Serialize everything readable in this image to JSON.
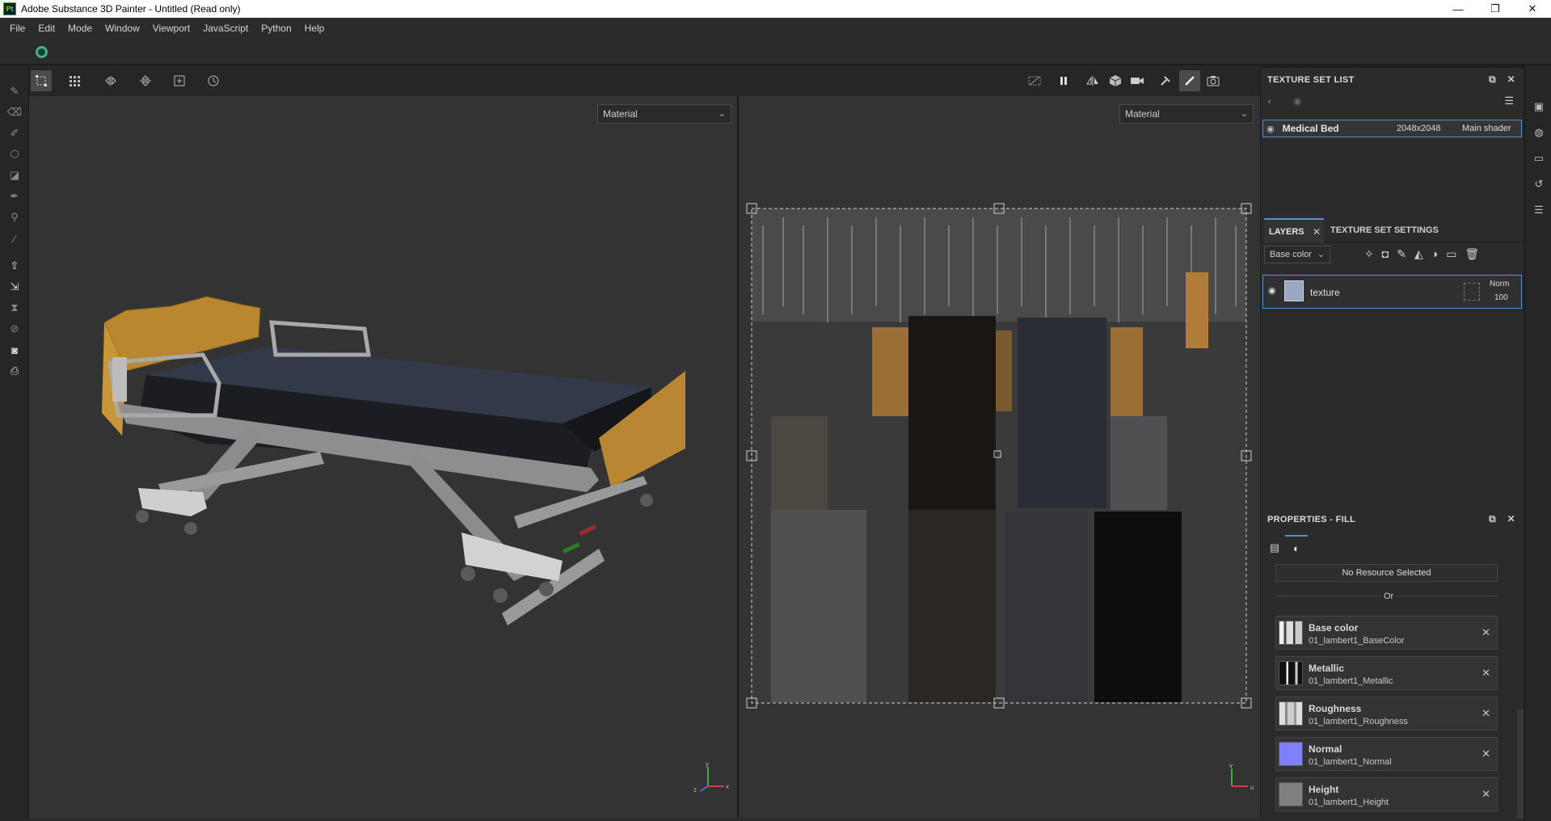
{
  "window": {
    "title": "Adobe Substance 3D Painter - Untitled (Read only)",
    "app_icon_text": "Pt",
    "minimize": "—",
    "maximize": "❐",
    "close": "✕"
  },
  "menu": [
    "File",
    "Edit",
    "Mode",
    "Window",
    "Viewport",
    "JavaScript",
    "Python",
    "Help"
  ],
  "viewport3d": {
    "display_select": "Material",
    "axis_labels": {
      "x": "x",
      "y": "y",
      "z": "z"
    }
  },
  "viewport2d": {
    "display_select": "Material",
    "axis_labels": {
      "v": "v",
      "u": "u"
    }
  },
  "texture_set_list": {
    "title": "TEXTURE SET LIST",
    "row": {
      "name": "Medical Bed",
      "resolution": "2048x2048",
      "shader": "Main shader"
    }
  },
  "layers_panel": {
    "tabs": [
      "LAYERS",
      "TEXTURE SET SETTINGS"
    ],
    "channel_select": "Base color",
    "layer": {
      "name": "texture",
      "blend": "Norm",
      "opacity": "100"
    }
  },
  "properties_fill": {
    "title": "PROPERTIES - FILL",
    "resource": "No Resource Selected",
    "or_label": "Or",
    "channels": [
      {
        "name": "Base color",
        "file": "01_lambert1_BaseColor",
        "thumb_color": "#d9d9d9"
      },
      {
        "name": "Metallic",
        "file": "01_lambert1_Metallic",
        "thumb_color": "#111111"
      },
      {
        "name": "Roughness",
        "file": "01_lambert1_Roughness",
        "thumb_color": "#c8c8c8"
      },
      {
        "name": "Normal",
        "file": "01_lambert1_Normal",
        "thumb_color": "#8080ff"
      },
      {
        "name": "Height",
        "file": "01_lambert1_Height",
        "thumb_color": "#7f7f7f"
      }
    ]
  },
  "colors": {
    "accent": "#5a8cd0",
    "panel_bg": "#2b2b2b",
    "viewport_bg": "#333333"
  }
}
